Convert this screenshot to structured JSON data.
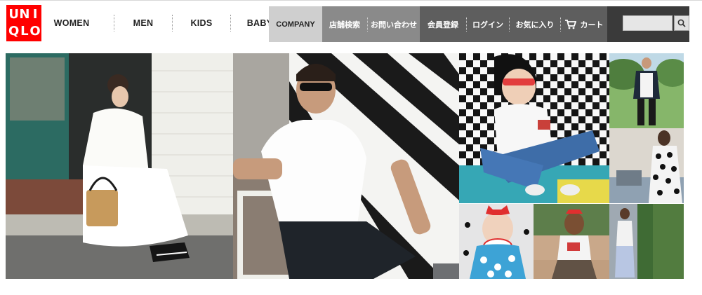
{
  "brand": {
    "logo_letters": [
      "U",
      "N",
      "I",
      "Q",
      "L",
      "O"
    ],
    "color": "#ff0000"
  },
  "main_nav": [
    {
      "label": "WOMEN"
    },
    {
      "label": "MEN"
    },
    {
      "label": "KIDS"
    },
    {
      "label": "BABY"
    }
  ],
  "company_link": "COMPANY",
  "store_links": [
    "店舗検索",
    "お問い合わせ"
  ],
  "account_links": [
    "会員登録",
    "ログイン",
    "お気に入り"
  ],
  "cart": {
    "label": "カート",
    "icon": "cart-icon"
  },
  "search": {
    "value": "",
    "placeholder": "",
    "icon": "search-icon"
  },
  "colors": {
    "company_bg": "#cfcfcf",
    "store_bg": "#8a8a8a",
    "account_bg": "#5e5e5e",
    "search_bg": "#3a3a3a"
  }
}
